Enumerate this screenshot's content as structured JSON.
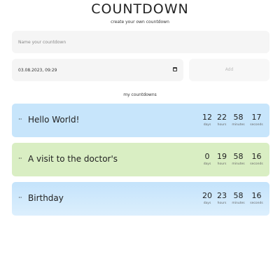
{
  "header": {
    "title": "COUNTDOWN",
    "subtitle": "create your own countdown"
  },
  "form": {
    "name_placeholder": "Name your countdown",
    "date_value": "03.08.2023, 09:29",
    "add_label": "Add"
  },
  "list": {
    "title": "my countdowns",
    "unit_labels": {
      "days": "days",
      "hours": "hours",
      "minutes": "minutes",
      "seconds": "seconds"
    },
    "items": [
      {
        "menu": "···",
        "name": "Hello World!",
        "days": "12",
        "hours": "22",
        "minutes": "58",
        "seconds": "17",
        "color": "#c7e5fb"
      },
      {
        "menu": "···",
        "name": "A visit to the doctor's",
        "days": "0",
        "hours": "19",
        "minutes": "58",
        "seconds": "16",
        "color": "#d9eec3"
      },
      {
        "menu": "···",
        "name": "Birthday",
        "days": "20",
        "hours": "23",
        "minutes": "58",
        "seconds": "16",
        "color": "#cfe8fb"
      }
    ]
  }
}
